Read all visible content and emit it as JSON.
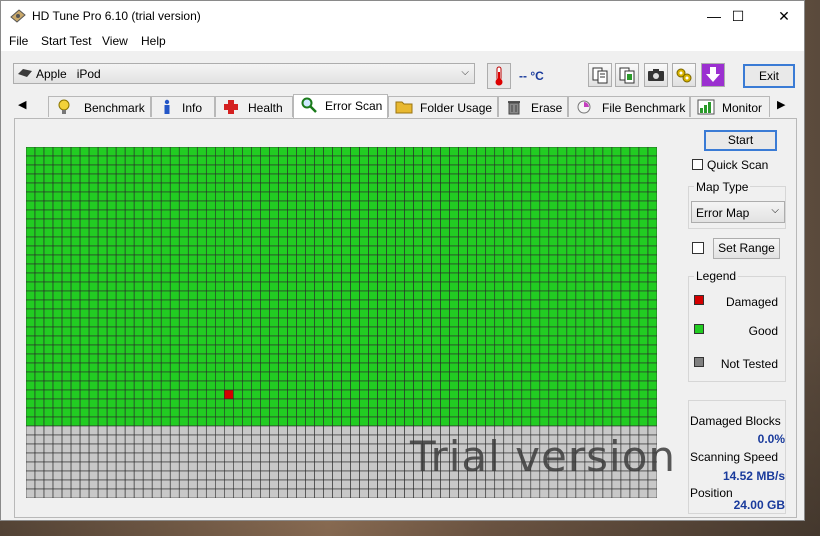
{
  "window": {
    "title": "HD Tune Pro 6.10 (trial version)",
    "minimize": "—",
    "maximize": "☐",
    "close": "✕"
  },
  "menu": [
    "File",
    "Start Test",
    "View",
    "Help"
  ],
  "drive": {
    "selected": "Apple   iPod"
  },
  "temperature": "-- °C",
  "exit_label": "Exit",
  "tabs": [
    {
      "label": "Benchmark",
      "icon": "bulb-icon"
    },
    {
      "label": "Info",
      "icon": "info-icon"
    },
    {
      "label": "Health",
      "icon": "cross-icon"
    },
    {
      "label": "Error Scan",
      "icon": "magnifier-icon",
      "active": true
    },
    {
      "label": "Folder Usage",
      "icon": "folder-icon"
    },
    {
      "label": "Erase",
      "icon": "trash-icon"
    },
    {
      "label": "File Benchmark",
      "icon": "file-bench-icon"
    },
    {
      "label": "Monitor",
      "icon": "monitor-chart-icon"
    }
  ],
  "scan": {
    "start_label": "Start",
    "quick_scan_label": "Quick Scan",
    "map_type_title": "Map Type",
    "map_type_value": "Error Map",
    "set_range_label": "Set Range",
    "legend_title": "Legend",
    "legend": [
      {
        "label": "Damaged",
        "color": "#d40000"
      },
      {
        "label": "Good",
        "color": "#22cc22"
      },
      {
        "label": "Not Tested",
        "color": "#808080"
      }
    ],
    "watermark": "Trial version",
    "map": {
      "cols": 70,
      "rows": 39,
      "tested_rows": 31,
      "damaged_cells": [
        [
          27,
          22
        ]
      ],
      "good_color": "#22cc22",
      "untested_color": "#c8c8c8",
      "damaged_color": "#d40000"
    }
  },
  "stats": {
    "damaged_blocks_label": "Damaged Blocks",
    "damaged_blocks_value": "0.0%",
    "scanning_speed_label": "Scanning Speed",
    "scanning_speed_value": "14.52 MB/s",
    "position_label": "Position",
    "position_value": "24.00 GB"
  }
}
